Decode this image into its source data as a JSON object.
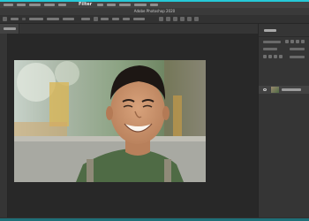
{
  "menubar": {
    "filter_label": "Filter"
  },
  "titlebar": {
    "title": "Adobe Photoshop 2020"
  },
  "photo": {
    "alt": "Smiling man in green t-shirt with backpack straps, outdoors"
  },
  "colors": {
    "accent": "#26c9d8",
    "menubar_bg": "#434343",
    "canvas_bg": "#282828",
    "panel_bg": "#353535"
  },
  "icons": {
    "layer_visibility": "eye-icon"
  }
}
